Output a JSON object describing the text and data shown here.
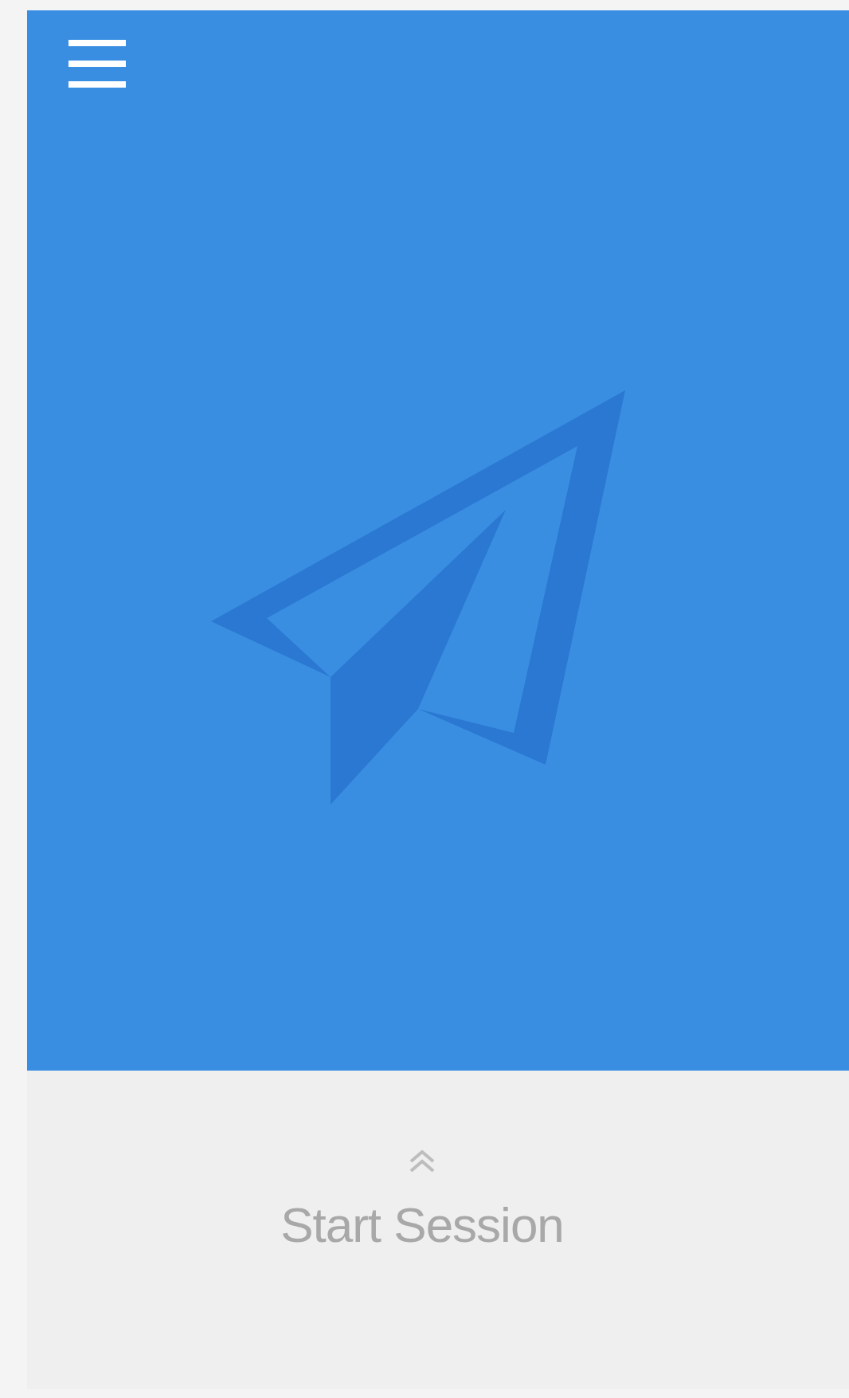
{
  "start_panel": {
    "label": "Start Session"
  }
}
